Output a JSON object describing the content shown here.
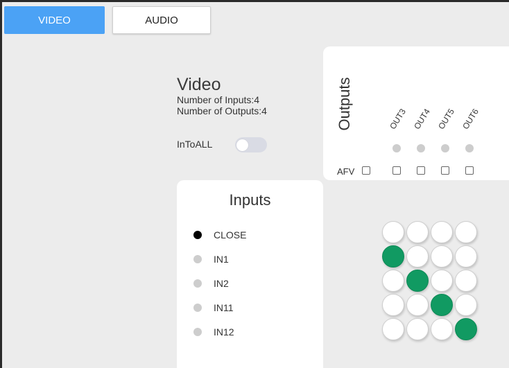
{
  "tabs": {
    "video": "VIDEO",
    "audio": "AUDIO"
  },
  "info": {
    "title": "Video",
    "num_inputs": "Number of Inputs:4",
    "num_outputs": "Number of Outputs:4",
    "intoall_label": "InToALL",
    "intoall_on": false
  },
  "outputs": {
    "title": "Outputs",
    "afv_label": "AFV",
    "items": [
      "OUT3",
      "OUT4",
      "OUT5",
      "OUT6"
    ]
  },
  "inputs": {
    "title": "Inputs",
    "items": [
      {
        "label": "CLOSE",
        "active": true
      },
      {
        "label": "IN1",
        "active": false
      },
      {
        "label": "IN2",
        "active": false
      },
      {
        "label": "IN11",
        "active": false
      },
      {
        "label": "IN12",
        "active": false
      }
    ]
  },
  "matrix": [
    [
      0,
      0,
      0,
      0
    ],
    [
      1,
      0,
      0,
      0
    ],
    [
      0,
      1,
      0,
      0
    ],
    [
      0,
      0,
      1,
      0
    ],
    [
      0,
      0,
      0,
      1
    ]
  ],
  "colors": {
    "accent": "#4ba2f5",
    "route_on": "#119a62",
    "dot_active": "#000000",
    "dot_idle": "#cdcdcd"
  }
}
